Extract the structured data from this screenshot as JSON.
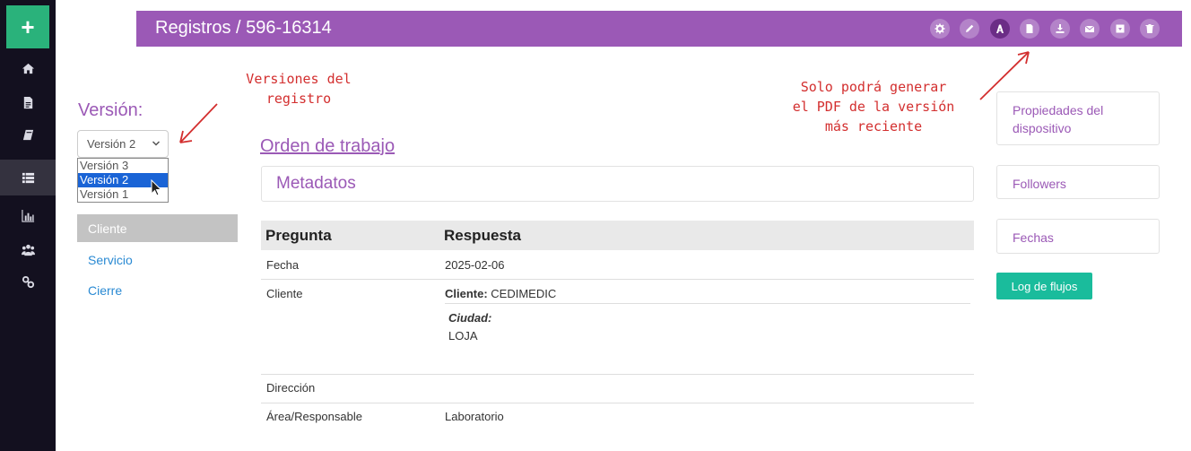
{
  "sidebar": {
    "add_label": "+",
    "items": [
      {
        "icon": "home-icon"
      },
      {
        "icon": "file-icon"
      },
      {
        "icon": "book-icon"
      },
      {
        "icon": "list-icon",
        "active": true
      },
      {
        "icon": "bar-chart-icon"
      },
      {
        "icon": "users-icon"
      },
      {
        "icon": "link-icon"
      }
    ]
  },
  "topbar": {
    "breadcrumb": "Registros / 596-16314",
    "actions": [
      "gear-icon",
      "pencil-icon",
      "pdf-icon",
      "document-icon",
      "download-icon",
      "envelope-icon",
      "archive-icon",
      "trash-icon"
    ],
    "active_action": "pdf-icon"
  },
  "version": {
    "label": "Versión:",
    "selected": "Versión 2",
    "options": [
      "Versión 3",
      "Versión 2",
      "Versión 1"
    ]
  },
  "sections": [
    "Cliente",
    "Servicio",
    "Cierre"
  ],
  "annotations": {
    "versions": "Versiones del\nregistro",
    "pdf": "Solo podrá generar\nel PDF de la versión\nmás reciente"
  },
  "form": {
    "title": "Orden de trabajo",
    "meta_title": "Metadatos",
    "headers": {
      "question": "Pregunta",
      "answer": "Respuesta"
    },
    "rows": {
      "fecha_q": "Fecha",
      "fecha_a": "2025-02-06",
      "cliente_q": "Cliente",
      "cliente_label": "Cliente:",
      "cliente_value": "CEDIMEDIC",
      "ciudad_label": "Ciudad:",
      "ciudad_value": "LOJA",
      "direccion_q": "Dirección",
      "area_q": "Área/Responsable",
      "area_a": "Laboratorio"
    }
  },
  "right_panel": {
    "device_props": "Propiedades del dispositivo",
    "followers": "Followers",
    "dates": "Fechas",
    "log_button": "Log de flujos"
  },
  "colors": {
    "brand_purple": "#9b59b6",
    "sidebar_dark": "#13101f",
    "accent_green": "#2ab27b",
    "teal_button": "#1abc9c",
    "annotation_red": "#d32f2f",
    "link_blue": "#2a8ad3"
  }
}
